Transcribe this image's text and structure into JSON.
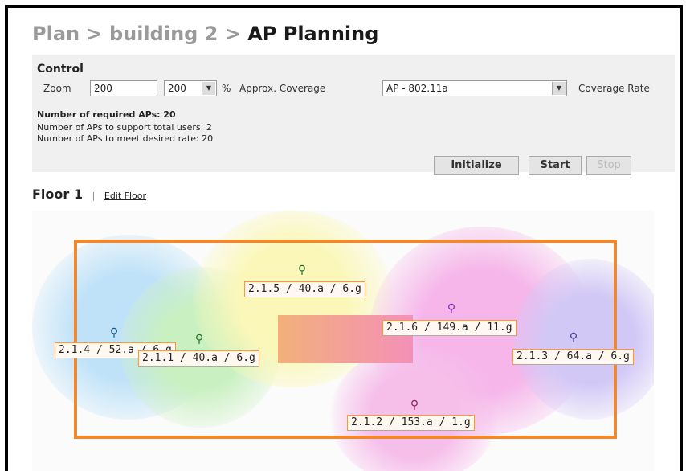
{
  "breadcrumb": {
    "part1": "Plan",
    "sep": ">",
    "part2": "building 2",
    "current": "AP Planning"
  },
  "control": {
    "heading": "Control",
    "zoom_label": "Zoom",
    "zoom_value": "200",
    "zoom_select": "200",
    "percent": "%",
    "coverage_label": "Approx. Coverage",
    "coverage_value": "AP - 802.11a",
    "coverage_rate_label": "Coverage Rate",
    "required": "Number of required APs: 20",
    "total_users": "Number of APs to support total users: 2",
    "desired_rate": "Number of APs to meet desired rate: 20",
    "buttons": {
      "initialize": "Initialize",
      "start": "Start",
      "stop": "Stop"
    }
  },
  "floor": {
    "title": "Floor 1",
    "sep": "|",
    "edit": "Edit Floor"
  },
  "aps": [
    {
      "label": "2.1.5 / 40.a / 6.g"
    },
    {
      "label": "2.1.6 / 149.a / 11.g"
    },
    {
      "label": "2.1.4 / 52.a / 6.g"
    },
    {
      "label": "2.1.1 / 40.a / 6.g"
    },
    {
      "label": "2.1.3 / 64.a / 6.g"
    },
    {
      "label": "2.1.2 / 153.a / 1.g"
    }
  ],
  "colors": {
    "building_outline": "#f08830",
    "label_border": "#e29b60"
  }
}
